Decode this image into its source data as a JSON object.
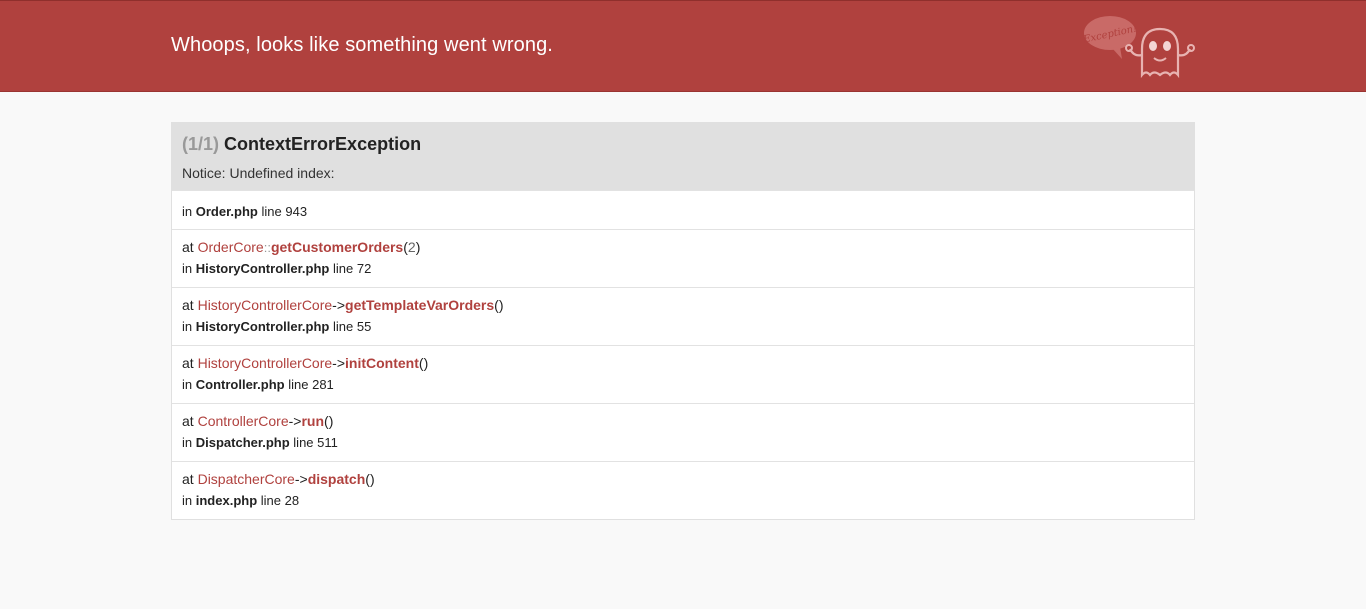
{
  "header": {
    "title": "Whoops, looks like something went wrong.",
    "logo_text": "Exception!"
  },
  "exception": {
    "count": "(1/1)",
    "name": "ContextErrorException",
    "message": "Notice: Undefined index:"
  },
  "first_location": {
    "in_label": "in",
    "file": "Order.php",
    "line_label": "line",
    "line": "943"
  },
  "frames": [
    {
      "at_label": "at",
      "class": "OrderCore",
      "separator": "::",
      "method": "getCustomerOrders",
      "open_paren": "(",
      "args": "2",
      "close_paren": ")",
      "in_label": "in",
      "file": "HistoryController.php",
      "line_label": "line",
      "line": "72"
    },
    {
      "at_label": "at",
      "class": "HistoryControllerCore",
      "separator": "->",
      "method": "getTemplateVarOrders",
      "open_paren": "(",
      "args": "",
      "close_paren": ")",
      "in_label": "in",
      "file": "HistoryController.php",
      "line_label": "line",
      "line": "55"
    },
    {
      "at_label": "at",
      "class": "HistoryControllerCore",
      "separator": "->",
      "method": "initContent",
      "open_paren": "(",
      "args": "",
      "close_paren": ")",
      "in_label": "in",
      "file": "Controller.php",
      "line_label": "line",
      "line": "281"
    },
    {
      "at_label": "at",
      "class": "ControllerCore",
      "separator": "->",
      "method": "run",
      "open_paren": "(",
      "args": "",
      "close_paren": ")",
      "in_label": "in",
      "file": "Dispatcher.php",
      "line_label": "line",
      "line": "511"
    },
    {
      "at_label": "at",
      "class": "DispatcherCore",
      "separator": "->",
      "method": "dispatch",
      "open_paren": "(",
      "args": "",
      "close_paren": ")",
      "in_label": "in",
      "file": "index.php",
      "line_label": "line",
      "line": "28"
    }
  ],
  "colors": {
    "header_bg": "#b0413e",
    "accent": "#b0413e",
    "page_bg": "#f9f9f9",
    "panel_head_bg": "#e0e0e0"
  }
}
